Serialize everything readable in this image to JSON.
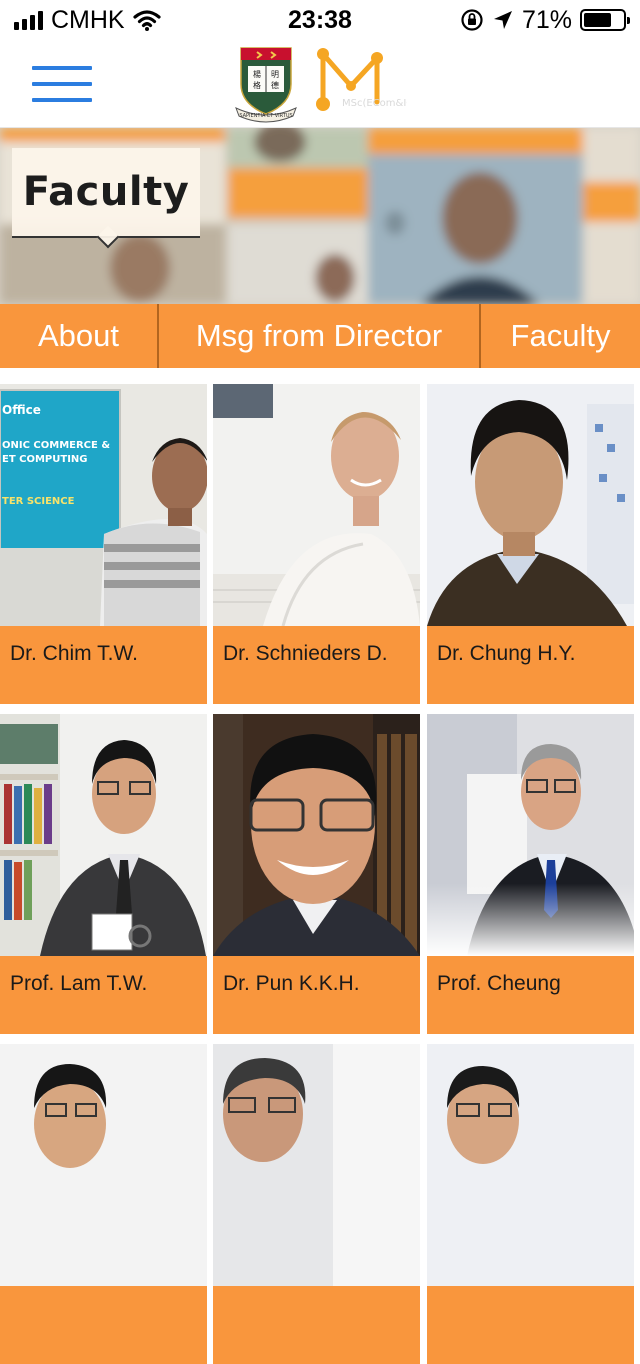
{
  "status_bar": {
    "carrier": "CMHK",
    "time": "23:38",
    "battery_percent": "71%",
    "battery_level": 0.71,
    "icons": [
      "signal-icon",
      "wifi-icon",
      "orientation-lock-icon",
      "location-arrow-icon",
      "battery-icon"
    ]
  },
  "header": {
    "menu_icon": "hamburger-menu-icon",
    "logos": [
      "hku-shield-logo",
      "msc-ecom-m-logo"
    ],
    "hku_motto": "SAPIENTIA ET VIRTUS",
    "m_logo_text": "MSc(ECom&IC)"
  },
  "hero": {
    "title": "Faculty"
  },
  "nav": {
    "tabs": [
      {
        "label": "About"
      },
      {
        "label": "Msg from Director"
      },
      {
        "label": "Faculty"
      }
    ]
  },
  "faculty": [
    {
      "name": "Dr. Chim T.W."
    },
    {
      "name": "Dr. Schnieders D."
    },
    {
      "name": "Dr. Chung H.Y."
    },
    {
      "name": "Prof. Lam T.W."
    },
    {
      "name": "Dr. Pun K.K.H."
    },
    {
      "name": "Prof. Cheung"
    },
    {
      "name": ""
    },
    {
      "name": ""
    },
    {
      "name": ""
    }
  ],
  "colors": {
    "accent_orange": "#f9963d",
    "menu_blue": "#2b7de0",
    "tab_divider": "#b2651f"
  }
}
